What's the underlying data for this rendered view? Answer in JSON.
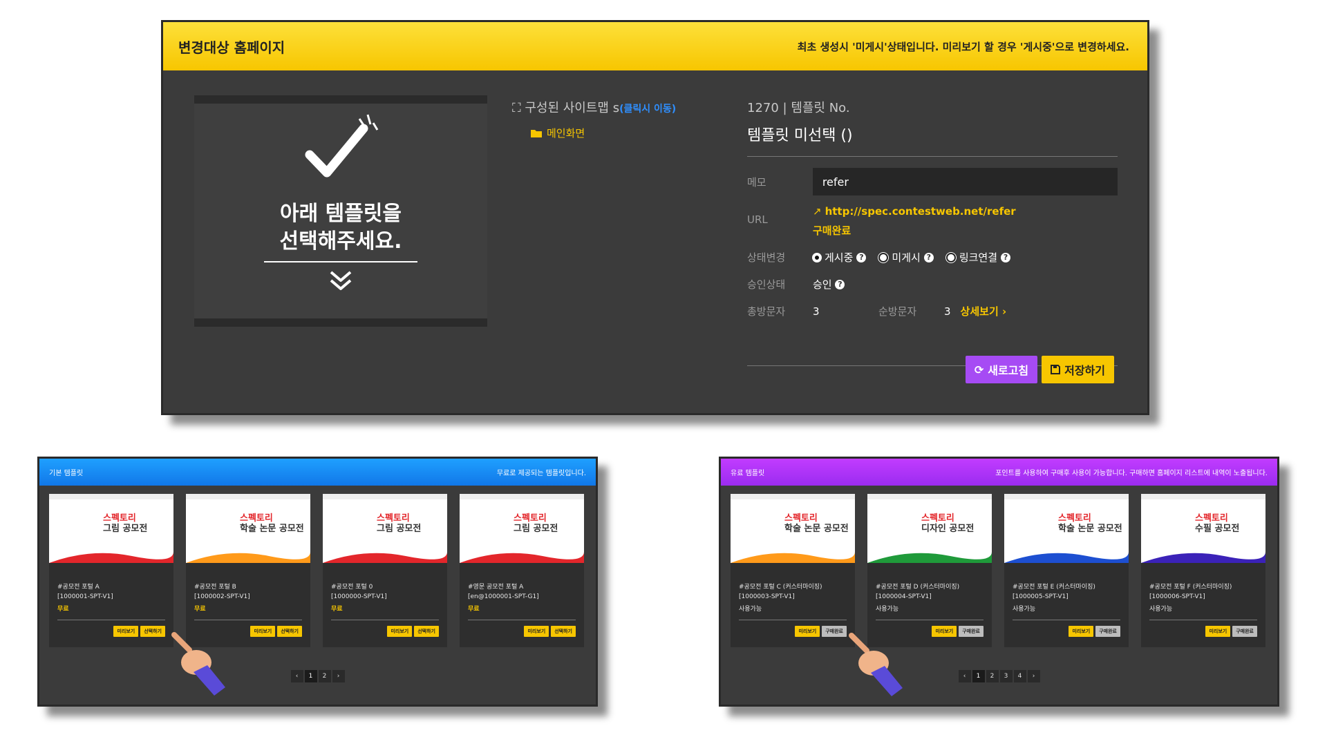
{
  "top": {
    "title": "변경대상 홈페이지",
    "notice": "최초 생성시 '미게시'상태입니다. 미리보기 할 경우 '게시중'으로 변경하세요.",
    "preview_line1": "아래 템플릿을",
    "preview_line2": "선택해주세요.",
    "sitemap_label": "구성된 사이트맵 s",
    "sitemap_link": "(클릭시 이동)",
    "sitemap_folder": "메인화면",
    "template_no": "1270 | 템플릿 No.",
    "template_name": "템플릿 미선택 ()",
    "memo_label": "메모",
    "memo_value": "refer",
    "url_label": "URL",
    "url_value": "http://spec.contestweb.net/refer",
    "purchase_status": "구매완료",
    "status_label": "상태변경",
    "status_options": [
      "게시중",
      "미게시",
      "링크연결"
    ],
    "approval_label": "승인상태",
    "approval_value": "승인",
    "total_visitors_label": "총방문자",
    "total_visitors": "3",
    "unique_visitors_label": "순방문자",
    "unique_visitors": "3",
    "detail_link": "상세보기",
    "refresh_button": "새로고침",
    "save_button": "저장하기"
  },
  "basic": {
    "title": "기본 템플릿",
    "note": "무료로 제공되는 템플릿입니다.",
    "cards": [
      {
        "name": "#공모전 포털 A",
        "code": "[1000001-SPT-V1]",
        "price": "무료",
        "slogan1": "스펙토리",
        "slogan2": "그림 공모전",
        "btn1": "미리보기",
        "btn2": "선택하기"
      },
      {
        "name": "#공모전 포털 B",
        "code": "[1000002-SPT-V1]",
        "price": "무료",
        "slogan1": "스펙토리",
        "slogan2": "학술 논문 공모전",
        "btn1": "미리보기",
        "btn2": "선택하기"
      },
      {
        "name": "#공모전 포털 0",
        "code": "[1000000-SPT-V1]",
        "price": "무료",
        "slogan1": "스펙토리",
        "slogan2": "그림 공모전",
        "btn1": "미리보기",
        "btn2": "선택하기"
      },
      {
        "name": "#영문 공모전 포털 A",
        "code": "[en@1000001-SPT-G1]",
        "price": "무료",
        "slogan1": "스펙토리",
        "slogan2": "그림 공모전",
        "btn1": "미리보기",
        "btn2": "선택하기"
      }
    ],
    "pages": [
      "1",
      "2"
    ]
  },
  "paid": {
    "title": "유료 템플릿",
    "note": "포인트를 사용하여 구매후 사용이 가능합니다. 구매하면 홈페이지 리스트에 내역이 노출됩니다.",
    "cards": [
      {
        "name": "#공모전 포털 C (커스터마이징)",
        "code": "[1000003-SPT-V1]",
        "price": "사용가능",
        "slogan1": "스펙토리",
        "slogan2": "학술 논문 공모전",
        "btn1": "미리보기",
        "btn2": "구매완료"
      },
      {
        "name": "#공모전 포털 D (커스터마이징)",
        "code": "[1000004-SPT-V1]",
        "price": "사용가능",
        "slogan1": "스펙토리",
        "slogan2": "디자인 공모전",
        "btn1": "미리보기",
        "btn2": "구매완료"
      },
      {
        "name": "#공모전 포털 E (커스터마이징)",
        "code": "[1000005-SPT-V1]",
        "price": "사용가능",
        "slogan1": "스펙토리",
        "slogan2": "학술 논문 공모전",
        "btn1": "미리보기",
        "btn2": "구매완료"
      },
      {
        "name": "#공모전 포털 F (커스터마이징)",
        "code": "[1000006-SPT-V1]",
        "price": "사용가능",
        "slogan1": "스펙토리",
        "slogan2": "수필 공모전",
        "btn1": "미리보기",
        "btn2": "구매완료"
      }
    ],
    "pages": [
      "1",
      "2",
      "3",
      "4"
    ]
  },
  "colors": {
    "yellow": "#f7c600",
    "purple": "#a64bf4",
    "blue": "#1fa0ff",
    "panel": "#3b3b3b"
  }
}
